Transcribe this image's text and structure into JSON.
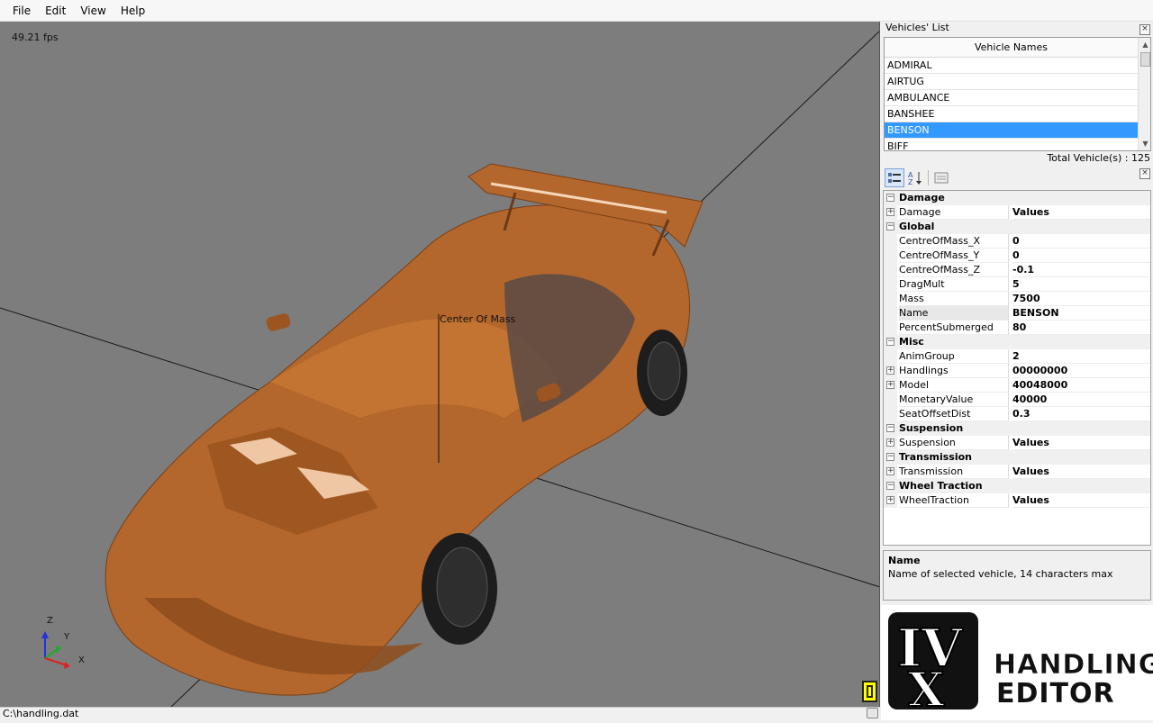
{
  "menu": {
    "items": [
      "File",
      "Edit",
      "View",
      "Help"
    ]
  },
  "viewport": {
    "fps": "49.21 fps",
    "center_of_mass_label": "Center Of Mass",
    "axis": {
      "z": "Z",
      "y": "Y",
      "x": "X"
    }
  },
  "statusbar": {
    "path": "C:\\handling.dat"
  },
  "vehicles_list": {
    "title": "Vehicles' List",
    "column_header": "Vehicle Names",
    "items": [
      "ADMIRAL",
      "AIRTUG",
      "AMBULANCE",
      "BANSHEE",
      "BENSON",
      "BIFF"
    ],
    "selected": "BENSON",
    "total": "Total Vehicle(s) : 125"
  },
  "property_grid": {
    "rows": [
      {
        "kind": "cat",
        "label": "Damage"
      },
      {
        "kind": "prop",
        "label": "Damage",
        "value": "Values",
        "expandable": true
      },
      {
        "kind": "cat",
        "label": "Global"
      },
      {
        "kind": "prop",
        "label": "CentreOfMass_X",
        "value": "0"
      },
      {
        "kind": "prop",
        "label": "CentreOfMass_Y",
        "value": "0"
      },
      {
        "kind": "prop",
        "label": "CentreOfMass_Z",
        "value": "-0.1"
      },
      {
        "kind": "prop",
        "label": "DragMult",
        "value": "5"
      },
      {
        "kind": "prop",
        "label": "Mass",
        "value": "7500"
      },
      {
        "kind": "prop",
        "label": "Name",
        "value": "BENSON",
        "selected": true
      },
      {
        "kind": "prop",
        "label": "PercentSubmerged",
        "value": "80"
      },
      {
        "kind": "cat",
        "label": "Misc"
      },
      {
        "kind": "prop",
        "label": "AnimGroup",
        "value": "2"
      },
      {
        "kind": "prop",
        "label": "Handlings",
        "value": "00000000",
        "expandable": true
      },
      {
        "kind": "prop",
        "label": "Model",
        "value": "40048000",
        "expandable": true
      },
      {
        "kind": "prop",
        "label": "MonetaryValue",
        "value": "40000"
      },
      {
        "kind": "prop",
        "label": "SeatOffsetDist",
        "value": "0.3"
      },
      {
        "kind": "cat",
        "label": "Suspension"
      },
      {
        "kind": "prop",
        "label": "Suspension",
        "value": "Values",
        "expandable": true
      },
      {
        "kind": "cat",
        "label": "Transmission"
      },
      {
        "kind": "prop",
        "label": "Transmission",
        "value": "Values",
        "expandable": true
      },
      {
        "kind": "cat",
        "label": "Wheel Traction"
      },
      {
        "kind": "prop",
        "label": "WheelTraction",
        "value": "Values",
        "expandable": true
      }
    ]
  },
  "help": {
    "title": "Name",
    "description": "Name of selected vehicle, 14 characters max"
  },
  "logo": {
    "mark": "IV",
    "line1": "HANDLING",
    "line2": "EDITOR"
  },
  "colors": {
    "car_body": "#b4672c",
    "viewport_bg": "#7d7d7d",
    "selection": "#3399ff"
  }
}
